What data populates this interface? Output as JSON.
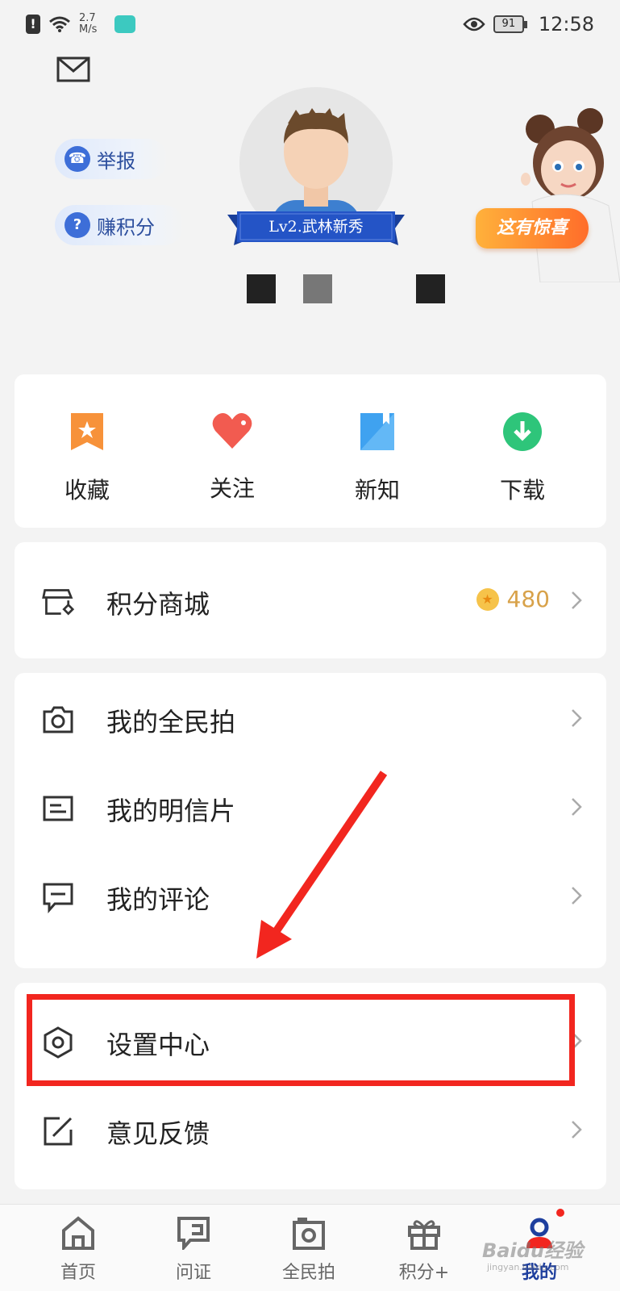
{
  "status_bar": {
    "speed": "2.7 M/s",
    "battery": "91",
    "time": "12:58"
  },
  "header": {
    "report_label": "举报",
    "earn_points_label": "赚积分",
    "level_badge": "Lv2.武林新秀",
    "surprise_label": "这有惊喜"
  },
  "quick_actions": [
    {
      "label": "收藏",
      "icon": "bookmark-star-icon",
      "color": "#f7923a"
    },
    {
      "label": "关注",
      "icon": "heart-icon",
      "color": "#f25b50"
    },
    {
      "label": "新知",
      "icon": "book-icon",
      "color": "#3fa2f0"
    },
    {
      "label": "下载",
      "icon": "download-icon",
      "color": "#2ec57a"
    }
  ],
  "points_mall": {
    "label": "积分商城",
    "points": "480"
  },
  "list_items": [
    {
      "label": "我的全民拍",
      "icon": "camera-icon"
    },
    {
      "label": "我的明信片",
      "icon": "postcard-icon"
    },
    {
      "label": "我的评论",
      "icon": "comment-icon"
    }
  ],
  "settings_items": [
    {
      "label": "设置中心",
      "icon": "hexagon-settings-icon"
    },
    {
      "label": "意见反馈",
      "icon": "edit-feedback-icon"
    }
  ],
  "bottom_nav": [
    {
      "label": "首页",
      "icon": "home-icon",
      "active": false
    },
    {
      "label": "问证",
      "icon": "query-icon",
      "active": false
    },
    {
      "label": "全民拍",
      "icon": "camera-frame-icon",
      "active": false
    },
    {
      "label": "积分+",
      "icon": "gift-icon",
      "active": false
    },
    {
      "label": "我的",
      "icon": "profile-icon",
      "active": true
    }
  ],
  "watermark": {
    "brand": "Baidu经验",
    "url": "jingyan.baidu.com"
  },
  "colors": {
    "accent_blue": "#1e3f9e",
    "highlight_red": "#f2261f",
    "points_gold": "#d8a24a"
  }
}
